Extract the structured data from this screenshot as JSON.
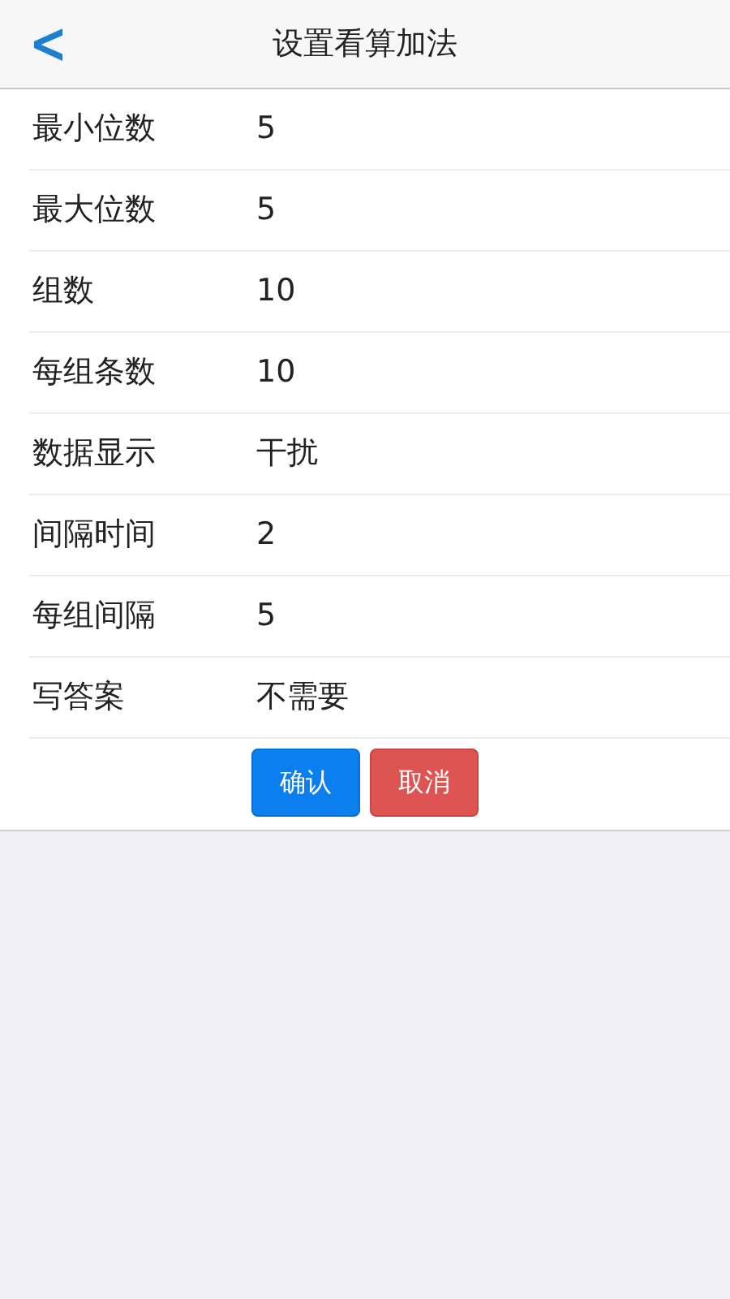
{
  "header": {
    "back": "<",
    "title": "设置看算加法"
  },
  "settings": [
    {
      "label": "最小位数",
      "value": "5"
    },
    {
      "label": "最大位数",
      "value": "5"
    },
    {
      "label": "组数",
      "value": "10"
    },
    {
      "label": "每组条数",
      "value": "10"
    },
    {
      "label": "数据显示",
      "value": "干扰"
    },
    {
      "label": "间隔时间",
      "value": "2"
    },
    {
      "label": "每组间隔",
      "value": "5"
    },
    {
      "label": "写答案",
      "value": "不需要"
    }
  ],
  "buttons": [
    {
      "label": "确认",
      "kind": "primary"
    },
    {
      "label": "取消",
      "kind": "danger"
    }
  ]
}
